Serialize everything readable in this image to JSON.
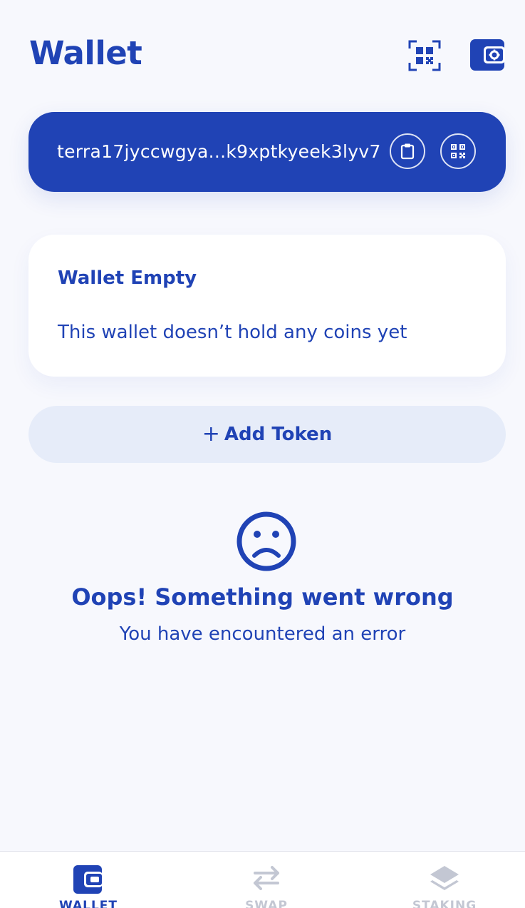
{
  "header": {
    "title": "Wallet"
  },
  "address": {
    "display": "terra17jyccwgya...k9xptkyeek3lyv7"
  },
  "wallet_empty": {
    "title": "Wallet Empty",
    "description": "This wallet doesn’t hold any coins yet"
  },
  "add_token": {
    "plus": "+",
    "label": "Add Token"
  },
  "error": {
    "title": "Oops! Something went wrong",
    "description": "You have encountered an error"
  },
  "nav": {
    "items": [
      {
        "label": "WALLET",
        "icon": "wallet-icon",
        "active": true
      },
      {
        "label": "SWAP",
        "icon": "swap-icon",
        "active": false
      },
      {
        "label": "STAKING",
        "icon": "staking-icon",
        "active": false
      }
    ]
  },
  "colors": {
    "primary": "#2043b5",
    "background": "#f7f8fd",
    "add_token_bg": "#e6ecf9",
    "inactive": "#c3c7d3"
  }
}
